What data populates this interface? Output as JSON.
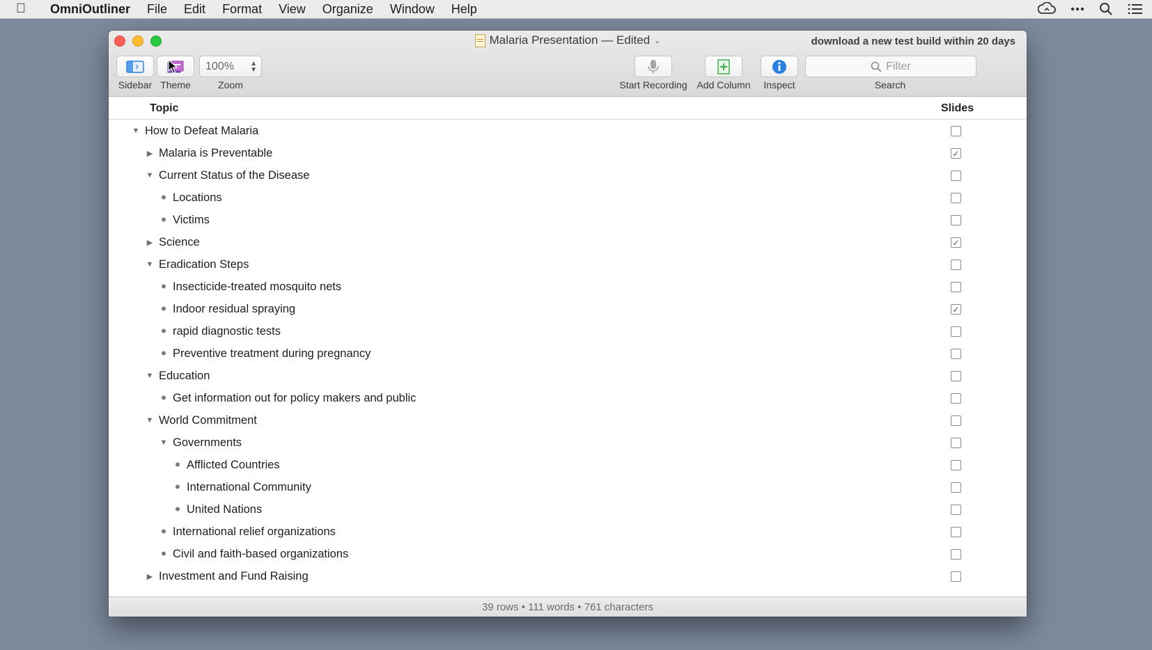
{
  "menubar": {
    "app_name": "OmniOutliner",
    "items": [
      "File",
      "Edit",
      "Format",
      "View",
      "Organize",
      "Window",
      "Help"
    ],
    "right_icons": [
      "creative-cloud-icon",
      "more-icon",
      "spotlight-search-icon",
      "notification-list-icon"
    ]
  },
  "window": {
    "title": "Malaria Presentation — Edited",
    "notice": "download a new test build within 20 days"
  },
  "toolbar": {
    "sidebar_label": "Sidebar",
    "theme_label": "Theme",
    "zoom_value": "100%",
    "zoom_label": "Zoom",
    "record_label": "Start Recording",
    "add_column_label": "Add Column",
    "inspect_label": "Inspect",
    "search_placeholder": "Filter",
    "search_label": "Search"
  },
  "columns": {
    "topic": "Topic",
    "slides": "Slides"
  },
  "rows": [
    {
      "text": "How to Defeat Malaria",
      "level": 0,
      "type": "expanded",
      "checked": false
    },
    {
      "text": "Malaria is Preventable",
      "level": 1,
      "type": "collapsed",
      "checked": true
    },
    {
      "text": "Current Status of the Disease",
      "level": 1,
      "type": "expanded",
      "checked": false
    },
    {
      "text": "Locations",
      "level": 2,
      "type": "bullet",
      "checked": false
    },
    {
      "text": "Victims",
      "level": 2,
      "type": "bullet",
      "checked": false
    },
    {
      "text": "Science",
      "level": 1,
      "type": "collapsed",
      "checked": true
    },
    {
      "text": "Eradication Steps",
      "level": 1,
      "type": "expanded",
      "checked": false
    },
    {
      "text": "Insecticide-treated mosquito nets",
      "level": 2,
      "type": "bullet",
      "checked": false
    },
    {
      "text": "Indoor residual spraying",
      "level": 2,
      "type": "bullet",
      "checked": true
    },
    {
      "text": "rapid diagnostic tests",
      "level": 2,
      "type": "bullet",
      "checked": false
    },
    {
      "text": "Preventive treatment during pregnancy",
      "level": 2,
      "type": "bullet",
      "checked": false
    },
    {
      "text": "Education",
      "level": 1,
      "type": "expanded",
      "checked": false
    },
    {
      "text": "Get information out for policy makers and public",
      "level": 2,
      "type": "bullet",
      "checked": false
    },
    {
      "text": "World Commitment",
      "level": 1,
      "type": "expanded",
      "checked": false
    },
    {
      "text": "Governments",
      "level": 2,
      "type": "expanded",
      "checked": false
    },
    {
      "text": "Afflicted Countries",
      "level": 3,
      "type": "bullet",
      "checked": false
    },
    {
      "text": "International Community",
      "level": 3,
      "type": "bullet",
      "checked": false
    },
    {
      "text": "United Nations",
      "level": 3,
      "type": "bullet",
      "checked": false
    },
    {
      "text": "International relief organizations",
      "level": 2,
      "type": "bullet",
      "checked": false
    },
    {
      "text": "Civil and faith-based organizations",
      "level": 2,
      "type": "bullet",
      "checked": false
    },
    {
      "text": "Investment and Fund Raising",
      "level": 1,
      "type": "collapsed",
      "checked": false
    }
  ],
  "status": "39 rows • 111 words • 761 characters",
  "colors": {
    "desktop": "#7d8a9c",
    "close": "#fc5f57",
    "minimize": "#fdbc2e",
    "maximize": "#28c840",
    "accent": "#2a7fe0",
    "add_column_green": "#3aa847"
  }
}
